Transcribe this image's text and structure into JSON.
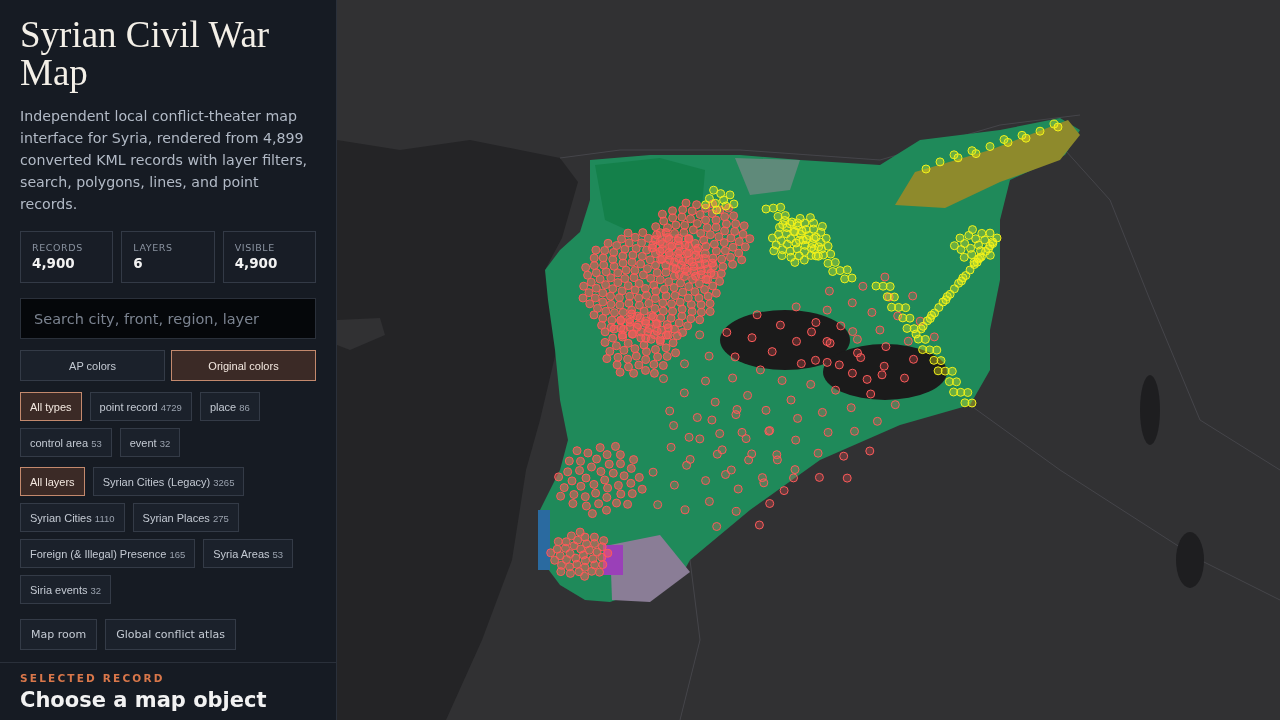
{
  "sidebar": {
    "title": "Syrian Civil War Map",
    "description": "Independent local conflict-theater map interface for Syria, rendered from 4,899 converted KML records with layer filters, search, polygons, lines, and point records.",
    "stats": [
      {
        "label": "RECORDS",
        "value": "4,900"
      },
      {
        "label": "LAYERS",
        "value": "6"
      },
      {
        "label": "VISIBLE",
        "value": "4,900"
      }
    ],
    "search": {
      "placeholder": "Search city, front, region, layer"
    },
    "color_modes": [
      {
        "label": "AP colors",
        "selected": false
      },
      {
        "label": "Original colors",
        "selected": true
      }
    ],
    "type_filters": [
      {
        "label": "All types",
        "selected": true
      },
      {
        "label": "point record",
        "count": "4729",
        "selected": false
      },
      {
        "label": "place",
        "count": "86",
        "selected": false
      },
      {
        "label": "control area",
        "count": "53",
        "selected": false
      },
      {
        "label": "event",
        "count": "32",
        "selected": false
      }
    ],
    "layer_filters": [
      {
        "label": "All layers",
        "selected": true
      },
      {
        "label": "Syrian Cities (Legacy)",
        "count": "3265",
        "selected": false
      },
      {
        "label": "Syrian Cities",
        "count": "1110",
        "selected": false
      },
      {
        "label": "Syrian Places",
        "count": "275",
        "selected": false
      },
      {
        "label": "Foreign (& Illegal) Presence",
        "count": "165",
        "selected": false
      },
      {
        "label": "Syria Areas",
        "count": "53",
        "selected": false
      },
      {
        "label": "Siria events",
        "count": "32",
        "selected": false
      }
    ],
    "links": [
      {
        "label": "Map room"
      },
      {
        "label": "Global conflict atlas"
      }
    ],
    "selected_record": {
      "heading": "SELECTED RECORD",
      "title": "Choose a map object"
    }
  }
}
